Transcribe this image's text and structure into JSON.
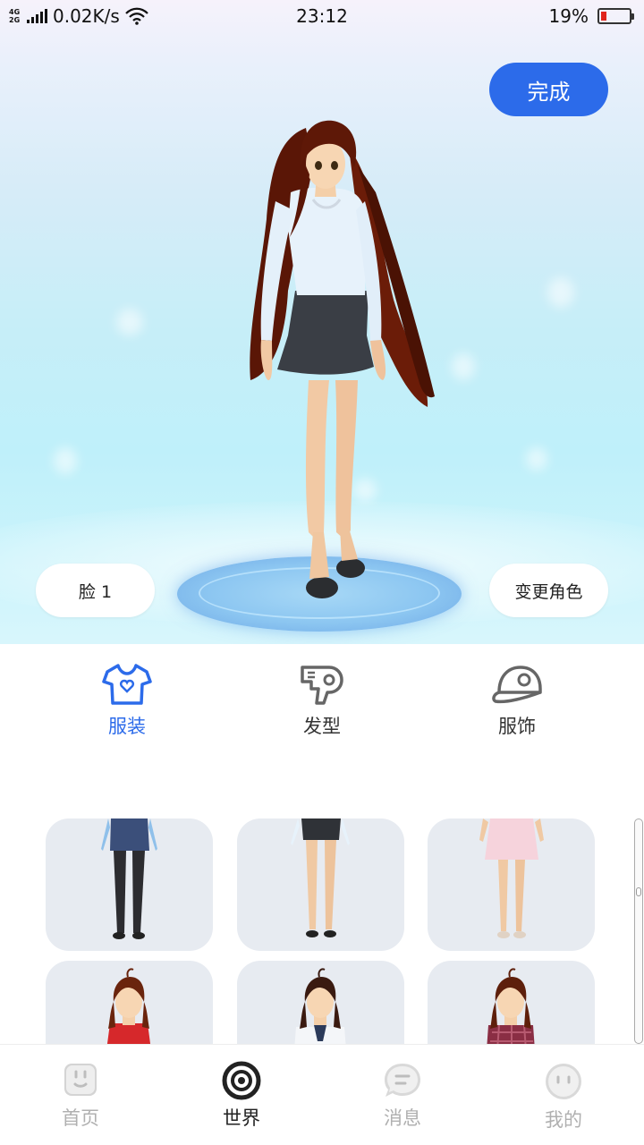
{
  "status_bar": {
    "network_type": "4G\n2G",
    "speed": "0.02K/s",
    "time": "23:12",
    "battery_percent": "19%",
    "battery_level": 0.19
  },
  "scene": {
    "done_label": "完成",
    "face_label": "脸 1",
    "change_role_label": "变更角色"
  },
  "categories": [
    {
      "label": "服装",
      "icon": "tshirt-icon",
      "active": true
    },
    {
      "label": "发型",
      "icon": "hairdryer-icon",
      "active": false
    },
    {
      "label": "服饰",
      "icon": "cap-icon",
      "active": false
    }
  ],
  "outfits": [
    {
      "name": "outfit-blue-skirt-black-tights"
    },
    {
      "name": "outfit-black-skirt"
    },
    {
      "name": "outfit-pink-dress"
    },
    {
      "name": "outfit-red-top"
    },
    {
      "name": "outfit-white-jacket"
    },
    {
      "name": "outfit-plaid-shirt"
    }
  ],
  "nav": [
    {
      "label": "首页",
      "icon": "home-face-icon",
      "active": false
    },
    {
      "label": "世界",
      "icon": "world-ring-icon",
      "active": true
    },
    {
      "label": "消息",
      "icon": "message-icon",
      "active": false
    },
    {
      "label": "我的",
      "icon": "profile-face-icon",
      "active": false
    }
  ],
  "colors": {
    "accent": "#2c6bea",
    "inactive": "#b0b0b0",
    "battery_low": "#e0241b"
  }
}
